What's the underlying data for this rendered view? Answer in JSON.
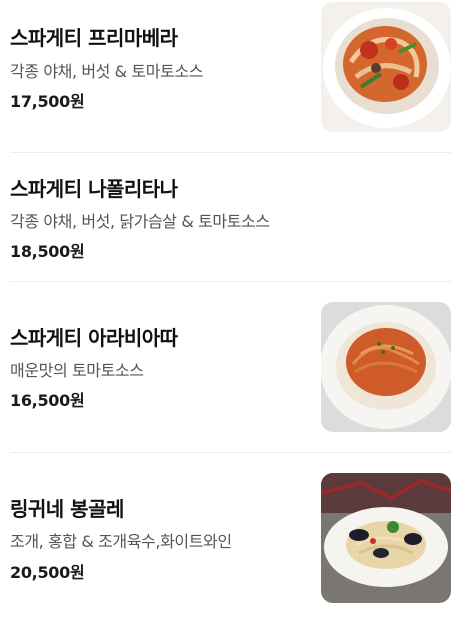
{
  "menu": {
    "items": [
      {
        "name": "스파게티 프리마베라",
        "description": "각종 야채, 버섯 & 토마토소스",
        "price": "17,500원",
        "image": "spaghetti-primavera-photo"
      },
      {
        "name": "스파게티 나폴리타나",
        "description": "각종 야채, 버섯, 닭가슴살 & 토마토소스",
        "price": "18,500원"
      },
      {
        "name": "스파게티 아라비아따",
        "description": "매운맛의 토마토소스",
        "price": "16,500원",
        "image": "spaghetti-arrabbiata-photo"
      },
      {
        "name": "링귀네 봉골레",
        "description": "조개, 홍합 & 조개육수,화이트와인",
        "price": "20,500원",
        "image": "linguine-vongole-photo"
      }
    ]
  }
}
